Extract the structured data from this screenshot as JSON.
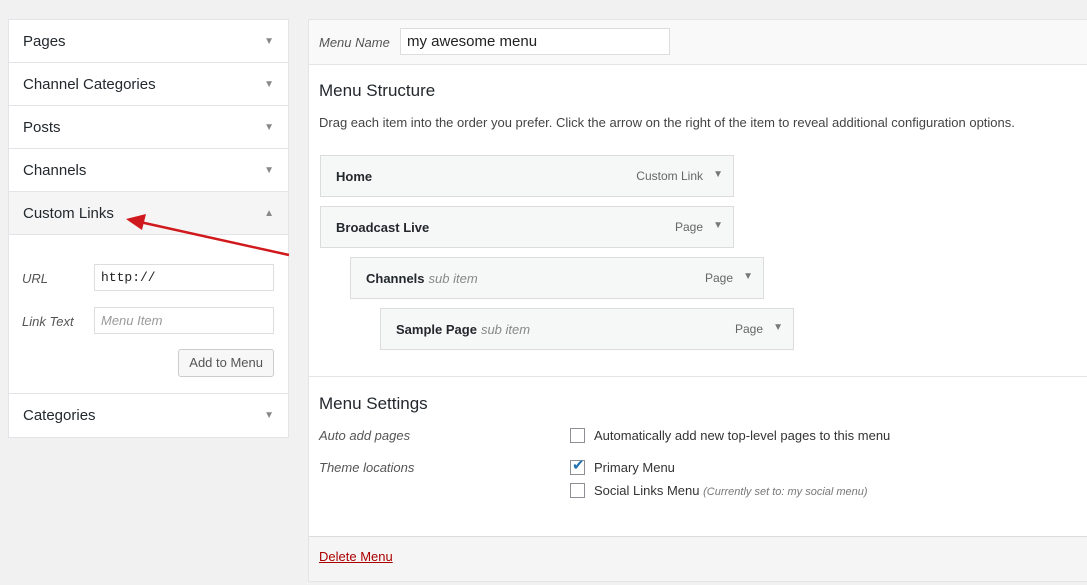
{
  "sidebar": {
    "panels": [
      {
        "label": "Pages"
      },
      {
        "label": "Channel Categories"
      },
      {
        "label": "Posts"
      },
      {
        "label": "Channels"
      },
      {
        "label": "Custom Links"
      },
      {
        "label": "Categories"
      }
    ],
    "custom_links": {
      "url_label": "URL",
      "url_value": "http://",
      "link_text_label": "Link Text",
      "link_text_placeholder": "Menu Item",
      "add_button": "Add to Menu"
    }
  },
  "main": {
    "menu_name_label": "Menu Name",
    "menu_name_value": "my awesome menu",
    "structure_heading": "Menu Structure",
    "structure_desc": "Drag each item into the order you prefer. Click the arrow on the right of the item to reveal additional configuration options.",
    "items": [
      {
        "title": "Home",
        "sub": "",
        "type": "Custom Link"
      },
      {
        "title": "Broadcast Live",
        "sub": "",
        "type": "Page"
      },
      {
        "title": "Channels",
        "sub": "sub item",
        "type": "Page"
      },
      {
        "title": "Sample Page",
        "sub": "sub item",
        "type": "Page"
      }
    ],
    "settings_heading": "Menu Settings",
    "auto_add_label": "Auto add pages",
    "auto_add_option": "Automatically add new top-level pages to this menu",
    "theme_locations_label": "Theme locations",
    "primary_menu_label": "Primary Menu",
    "social_menu_label": "Social Links Menu",
    "social_menu_note": "(Currently set to: my social menu)",
    "delete_link": "Delete Menu"
  },
  "icons": {
    "collapsed": "triangle-down",
    "expanded": "triangle-up",
    "checkmark": "check",
    "annotation": "red-arrow"
  },
  "colors": {
    "annotation_arrow": "#d0191c",
    "delete_link": "#aa0000",
    "checkbox_check": "#2271b1"
  },
  "state": {
    "primary_menu_checked": true,
    "social_menu_checked": false,
    "auto_add_checked": false,
    "expanded_panel": "Custom Links"
  }
}
